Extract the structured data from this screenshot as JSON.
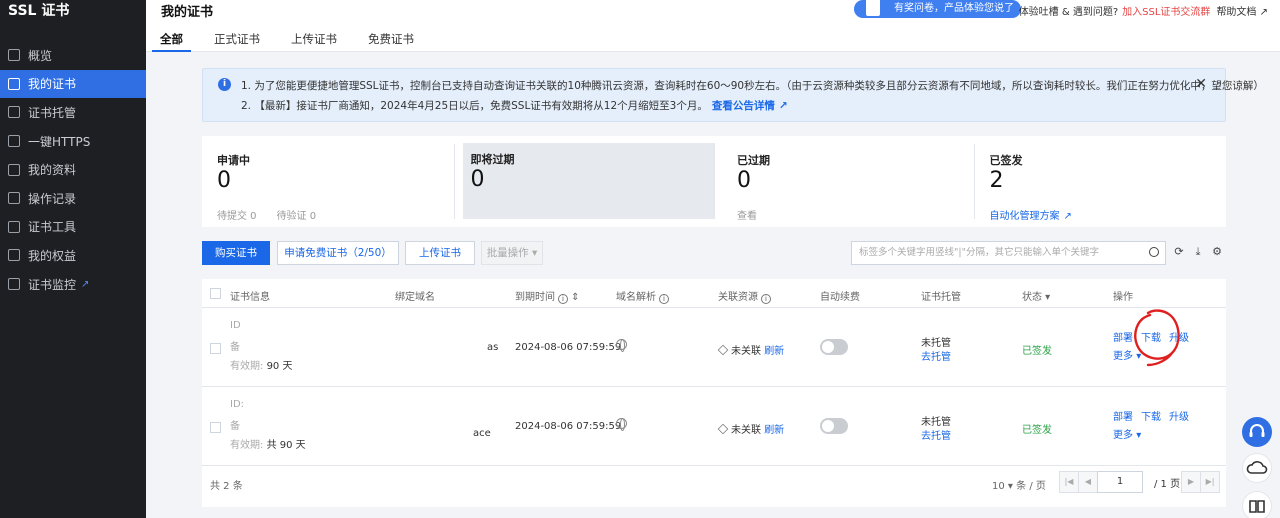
{
  "sidebar": {
    "brand": "SSL 证书",
    "items": [
      {
        "label": "概览",
        "icon": "grid-icon"
      },
      {
        "label": "我的证书",
        "icon": "certificate-icon",
        "active": true
      },
      {
        "label": "证书托管",
        "icon": "hosting-icon"
      },
      {
        "label": "一键HTTPS",
        "icon": "https-icon"
      },
      {
        "label": "我的资料",
        "icon": "folder-icon"
      },
      {
        "label": "操作记录",
        "icon": "log-icon"
      },
      {
        "label": "证书工具",
        "icon": "tool-icon"
      },
      {
        "label": "我的权益",
        "icon": "gift-icon"
      },
      {
        "label": "证书监控",
        "icon": "monitor-icon",
        "external": true
      }
    ]
  },
  "header": {
    "title": "我的证书",
    "tabs": [
      {
        "label": "全部",
        "active": true
      },
      {
        "label": "正式证书"
      },
      {
        "label": "上传证书"
      },
      {
        "label": "免费证书"
      }
    ],
    "survey": "有奖问卷，产品体验您说了算",
    "feedback": "体验吐槽 & 遇到问题?",
    "group_link": "加入SSL证书交流群",
    "docs": "帮助文档"
  },
  "notice": {
    "line1": "1. 为了您能更便捷地管理SSL证书，控制台已支持自动查询证书关联的10种腾讯云资源，查询耗时在60～90秒左右。（由于云资源种类较多且部分云资源有不同地域，所以查询耗时较长。我们正在努力优化中，望您谅解）",
    "line2": "2. 【最新】接证书厂商通知，2024年4月25日以后，免费SSL证书有效期将从12个月缩短至3个月。",
    "line2_link": "查看公告详情"
  },
  "stats": [
    {
      "label": "申请中",
      "value": "0",
      "sub1": "待提交 0",
      "sub2": "待验证 0"
    },
    {
      "label": "即将过期",
      "value": "0",
      "selected": true
    },
    {
      "label": "已过期",
      "value": "0",
      "sub1": "查看"
    },
    {
      "label": "已签发",
      "value": "2",
      "link": "自动化管理方案"
    }
  ],
  "toolbar": {
    "buy": "购买证书",
    "apply_free": "申请免费证书（2/50）",
    "upload": "上传证书",
    "batch": "批量操作",
    "search_placeholder": "标签多个关键字用竖线\"|\"分隔，其它只能输入单个关键字"
  },
  "table": {
    "columns": [
      "证书信息",
      "绑定域名",
      "到期时间",
      "域名解析",
      "关联资源",
      "自动续费",
      "证书托管",
      "状态",
      "操作"
    ],
    "rows": [
      {
        "id_label": "ID",
        "name_label": "备",
        "validity_label": "有效期:",
        "validity_value": "90 天",
        "domain": "as",
        "expire": "2024-08-06 07:59:59",
        "resource": "未关联",
        "refresh": "刷新",
        "hosting": "未托管",
        "hosting_action": "去托管",
        "status": "已签发",
        "ops": [
          "部署",
          "下载",
          "升级"
        ],
        "more": "更多"
      },
      {
        "id_label": "ID:",
        "name_label": "备",
        "validity_label": "有效期:",
        "validity_value": "共 90 天",
        "domain": "ace",
        "expire": "2024-08-06 07:59:59",
        "resource": "未关联",
        "refresh": "刷新",
        "hosting": "未托管",
        "hosting_action": "去托管",
        "status": "已签发",
        "ops": [
          "部署",
          "下载",
          "升级"
        ],
        "more": "更多"
      }
    ],
    "total": "共 2 条",
    "page_size": "10",
    "page_size_unit": "条 / 页",
    "page": "1",
    "page_total": "/ 1 页"
  },
  "colors": {
    "primary": "#1a68e8",
    "sidebar": "#1d1f23",
    "success": "#2ba245",
    "annotation": "#e02020"
  }
}
